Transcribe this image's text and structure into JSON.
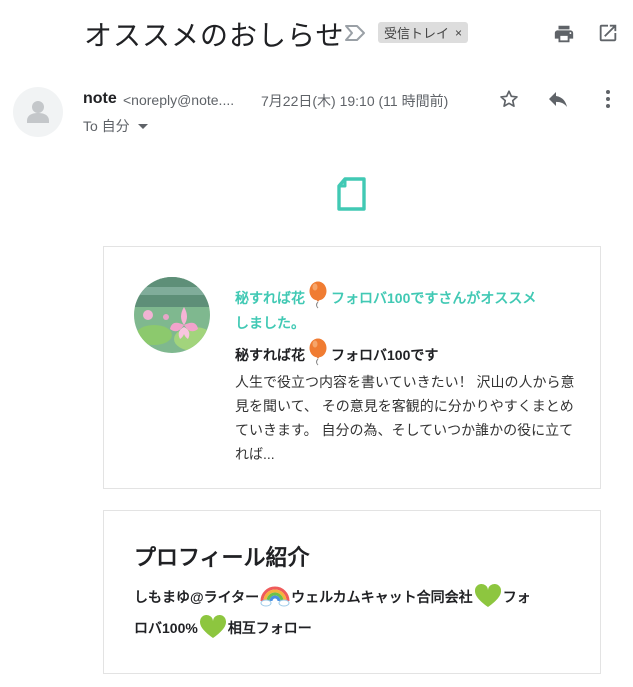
{
  "email": {
    "subject": "オススメのおしらせ",
    "label": "受信トレイ",
    "label_remove": "×",
    "sender_name": "note",
    "sender_email": "<noreply@note....",
    "date": "7月22日(木) 19:10 (11 時間前)",
    "recipient": "To 自分"
  },
  "icons": {
    "importance": "importance-marker-icon",
    "print": "print-icon",
    "open_new_window": "open-in-new-window-icon",
    "star": "star-icon",
    "reply": "reply-icon",
    "more": "more-vert-icon",
    "avatar": "person-icon",
    "note_logo": "note-document-icon"
  },
  "recommendation": {
    "title_part1": "秘すれば花",
    "title_part2": "フォロバ100ですさんがオススメ",
    "title_part3": "しました。",
    "creator_part1": "秘すれば花",
    "creator_part2": "フォロバ100です",
    "description": "人生で役立つ内容を書いていきたい！ 沢山の人から意見を聞いて、 その意見を客観的に分かりやすくまとめていきます。 自分の為、そしていつか誰かの役に立てれば..."
  },
  "profile": {
    "heading": "プロフィール紹介",
    "line1_part1": "しもまゆ@ライター",
    "line1_part2": "ウェルカムキャット合同会社",
    "line1_part3": "フォ",
    "line2_part1": "ロバ100%",
    "line2_part2": "相互フォロー"
  },
  "colors": {
    "accent": "#41c9b4",
    "label_bg": "#dddddd"
  }
}
